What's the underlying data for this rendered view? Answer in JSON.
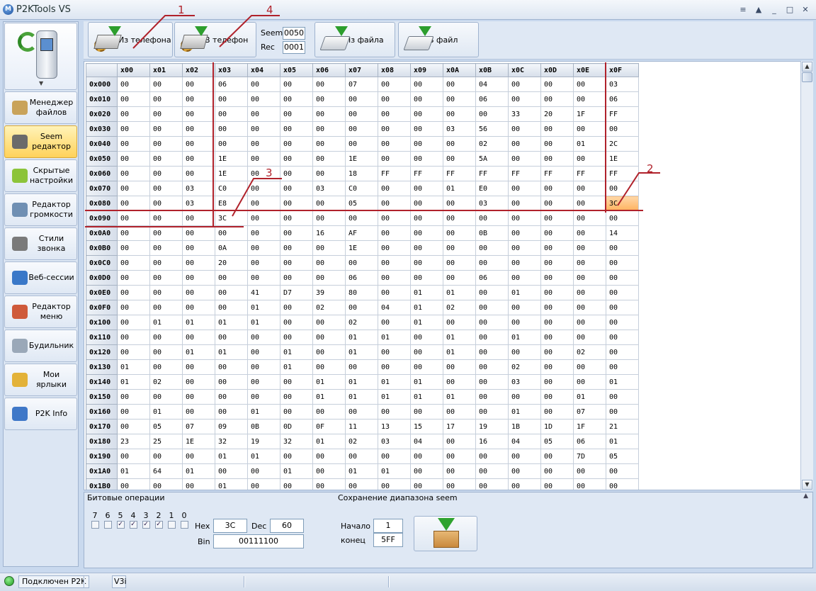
{
  "window": {
    "title": "P2KTools VS",
    "controls": [
      "≡",
      "▲",
      "_",
      "□",
      "✕"
    ]
  },
  "sidebar": {
    "items": [
      {
        "label": "Менеджер файлов",
        "icon": "folder-magnifier-icon",
        "active": false
      },
      {
        "label": "Seem редактор",
        "icon": "chip-editor-icon",
        "active": true
      },
      {
        "label": "Скрытые настройки",
        "icon": "gears-icon",
        "active": false
      },
      {
        "label": "Редактор громкости",
        "icon": "speaker-icon",
        "active": false
      },
      {
        "label": "Стили звонка",
        "icon": "ringtone-icon",
        "active": false
      },
      {
        "label": "Веб-сессии",
        "icon": "globe-icon",
        "active": false
      },
      {
        "label": "Редактор меню",
        "icon": "menu-editor-icon",
        "active": false
      },
      {
        "label": "Будильник",
        "icon": "alarm-clock-icon",
        "active": false
      },
      {
        "label": "Мои ярлыки",
        "icon": "shortcut-icon",
        "active": false
      },
      {
        "label": "P2K Info",
        "icon": "info-icon",
        "active": false
      }
    ]
  },
  "toolbar": {
    "from_phone": "Из телефона",
    "to_phone": "В телефон",
    "seem_label": "Seem",
    "seem_value": "0050",
    "rec_label": "Rec",
    "rec_value": "0001",
    "from_file": "Из файла",
    "to_file": "В файл"
  },
  "grid": {
    "columns": [
      "x00",
      "x01",
      "x02",
      "x03",
      "x04",
      "x05",
      "x06",
      "x07",
      "x08",
      "x09",
      "x0A",
      "x0B",
      "x0C",
      "x0D",
      "x0E",
      "x0F"
    ],
    "selected": {
      "row": "0x080",
      "col": "x0F"
    },
    "rows": [
      {
        "addr": "0x000",
        "cells": [
          "00",
          "00",
          "00",
          "06",
          "00",
          "00",
          "00",
          "07",
          "00",
          "00",
          "00",
          "04",
          "00",
          "00",
          "00",
          "03"
        ]
      },
      {
        "addr": "0x010",
        "cells": [
          "00",
          "00",
          "00",
          "00",
          "00",
          "00",
          "00",
          "00",
          "00",
          "00",
          "00",
          "06",
          "00",
          "00",
          "00",
          "06"
        ]
      },
      {
        "addr": "0x020",
        "cells": [
          "00",
          "00",
          "00",
          "00",
          "00",
          "00",
          "00",
          "00",
          "00",
          "00",
          "00",
          "00",
          "33",
          "20",
          "1F",
          "FF"
        ]
      },
      {
        "addr": "0x030",
        "cells": [
          "00",
          "00",
          "00",
          "00",
          "00",
          "00",
          "00",
          "00",
          "00",
          "00",
          "03",
          "56",
          "00",
          "00",
          "00",
          "00"
        ]
      },
      {
        "addr": "0x040",
        "cells": [
          "00",
          "00",
          "00",
          "00",
          "00",
          "00",
          "00",
          "00",
          "00",
          "00",
          "00",
          "02",
          "00",
          "00",
          "01",
          "2C"
        ]
      },
      {
        "addr": "0x050",
        "cells": [
          "00",
          "00",
          "00",
          "1E",
          "00",
          "00",
          "00",
          "1E",
          "00",
          "00",
          "00",
          "5A",
          "00",
          "00",
          "00",
          "1E"
        ]
      },
      {
        "addr": "0x060",
        "cells": [
          "00",
          "00",
          "00",
          "1E",
          "00",
          "00",
          "00",
          "18",
          "FF",
          "FF",
          "FF",
          "FF",
          "FF",
          "FF",
          "FF",
          "FF"
        ]
      },
      {
        "addr": "0x070",
        "cells": [
          "00",
          "00",
          "03",
          "C0",
          "00",
          "00",
          "03",
          "C0",
          "00",
          "00",
          "01",
          "E0",
          "00",
          "00",
          "00",
          "00"
        ]
      },
      {
        "addr": "0x080",
        "cells": [
          "00",
          "00",
          "03",
          "E8",
          "00",
          "00",
          "00",
          "05",
          "00",
          "00",
          "00",
          "03",
          "00",
          "00",
          "00",
          "3C"
        ]
      },
      {
        "addr": "0x090",
        "cells": [
          "00",
          "00",
          "00",
          "3C",
          "00",
          "00",
          "00",
          "00",
          "00",
          "00",
          "00",
          "00",
          "00",
          "00",
          "00",
          "00"
        ]
      },
      {
        "addr": "0x0A0",
        "cells": [
          "00",
          "00",
          "00",
          "00",
          "00",
          "00",
          "16",
          "AF",
          "00",
          "00",
          "00",
          "0B",
          "00",
          "00",
          "00",
          "14"
        ]
      },
      {
        "addr": "0x0B0",
        "cells": [
          "00",
          "00",
          "00",
          "0A",
          "00",
          "00",
          "00",
          "1E",
          "00",
          "00",
          "00",
          "00",
          "00",
          "00",
          "00",
          "00"
        ]
      },
      {
        "addr": "0x0C0",
        "cells": [
          "00",
          "00",
          "00",
          "20",
          "00",
          "00",
          "00",
          "00",
          "00",
          "00",
          "00",
          "00",
          "00",
          "00",
          "00",
          "00"
        ]
      },
      {
        "addr": "0x0D0",
        "cells": [
          "00",
          "00",
          "00",
          "00",
          "00",
          "00",
          "00",
          "06",
          "00",
          "00",
          "00",
          "06",
          "00",
          "00",
          "00",
          "00"
        ]
      },
      {
        "addr": "0x0E0",
        "cells": [
          "00",
          "00",
          "00",
          "00",
          "41",
          "D7",
          "39",
          "80",
          "00",
          "01",
          "01",
          "00",
          "01",
          "00",
          "00",
          "00"
        ]
      },
      {
        "addr": "0x0F0",
        "cells": [
          "00",
          "00",
          "00",
          "00",
          "01",
          "00",
          "02",
          "00",
          "04",
          "01",
          "02",
          "00",
          "00",
          "00",
          "00",
          "00"
        ]
      },
      {
        "addr": "0x100",
        "cells": [
          "00",
          "01",
          "01",
          "01",
          "01",
          "00",
          "00",
          "02",
          "00",
          "01",
          "00",
          "00",
          "00",
          "00",
          "00",
          "00"
        ]
      },
      {
        "addr": "0x110",
        "cells": [
          "00",
          "00",
          "00",
          "00",
          "00",
          "00",
          "00",
          "01",
          "01",
          "00",
          "01",
          "00",
          "01",
          "00",
          "00",
          "00"
        ]
      },
      {
        "addr": "0x120",
        "cells": [
          "00",
          "00",
          "01",
          "01",
          "00",
          "01",
          "00",
          "01",
          "00",
          "00",
          "01",
          "00",
          "00",
          "00",
          "02",
          "00"
        ]
      },
      {
        "addr": "0x130",
        "cells": [
          "01",
          "00",
          "00",
          "00",
          "00",
          "01",
          "00",
          "00",
          "00",
          "00",
          "00",
          "00",
          "02",
          "00",
          "00",
          "00"
        ]
      },
      {
        "addr": "0x140",
        "cells": [
          "01",
          "02",
          "00",
          "00",
          "00",
          "00",
          "01",
          "01",
          "01",
          "01",
          "00",
          "00",
          "03",
          "00",
          "00",
          "01"
        ]
      },
      {
        "addr": "0x150",
        "cells": [
          "00",
          "00",
          "00",
          "00",
          "00",
          "00",
          "01",
          "01",
          "01",
          "01",
          "01",
          "00",
          "00",
          "00",
          "01",
          "00"
        ]
      },
      {
        "addr": "0x160",
        "cells": [
          "00",
          "01",
          "00",
          "00",
          "01",
          "00",
          "00",
          "00",
          "00",
          "00",
          "00",
          "00",
          "01",
          "00",
          "07",
          "00"
        ]
      },
      {
        "addr": "0x170",
        "cells": [
          "00",
          "05",
          "07",
          "09",
          "0B",
          "0D",
          "0F",
          "11",
          "13",
          "15",
          "17",
          "19",
          "1B",
          "1D",
          "1F",
          "21"
        ]
      },
      {
        "addr": "0x180",
        "cells": [
          "23",
          "25",
          "1E",
          "32",
          "19",
          "32",
          "01",
          "02",
          "03",
          "04",
          "00",
          "16",
          "04",
          "05",
          "06",
          "01"
        ]
      },
      {
        "addr": "0x190",
        "cells": [
          "00",
          "00",
          "00",
          "01",
          "01",
          "00",
          "00",
          "00",
          "00",
          "00",
          "00",
          "00",
          "00",
          "00",
          "7D",
          "05"
        ]
      },
      {
        "addr": "0x1A0",
        "cells": [
          "01",
          "64",
          "01",
          "00",
          "00",
          "01",
          "00",
          "01",
          "01",
          "00",
          "00",
          "00",
          "00",
          "00",
          "00",
          "00"
        ]
      },
      {
        "addr": "0x1B0",
        "cells": [
          "00",
          "00",
          "00",
          "01",
          "00",
          "00",
          "00",
          "00",
          "00",
          "00",
          "00",
          "00",
          "00",
          "00",
          "00",
          "00"
        ]
      }
    ]
  },
  "bitops": {
    "title": "Битовые операции",
    "bit_labels": [
      "7",
      "6",
      "5",
      "4",
      "3",
      "2",
      "1",
      "0"
    ],
    "bit_states": [
      false,
      false,
      true,
      true,
      true,
      true,
      false,
      false
    ],
    "hex_label": "Hex",
    "hex_value": "3C",
    "dec_label": "Dec",
    "dec_value": "60",
    "bin_label": "Bin",
    "bin_value": "00111100"
  },
  "save_range": {
    "title": "Сохранение диапазона seem",
    "start_label": "Начало",
    "start_value": "1",
    "end_label": "конец",
    "end_value": "5FF"
  },
  "statusbar": {
    "connection": "Подключен P2K",
    "model": "V3i"
  },
  "annotations": [
    "1",
    "2",
    "3",
    "4"
  ],
  "colors": {
    "accent_active": "#ffd25a",
    "selection": "#ffb25e",
    "annotation": "#b0222b",
    "led": "#1f9a1f"
  }
}
